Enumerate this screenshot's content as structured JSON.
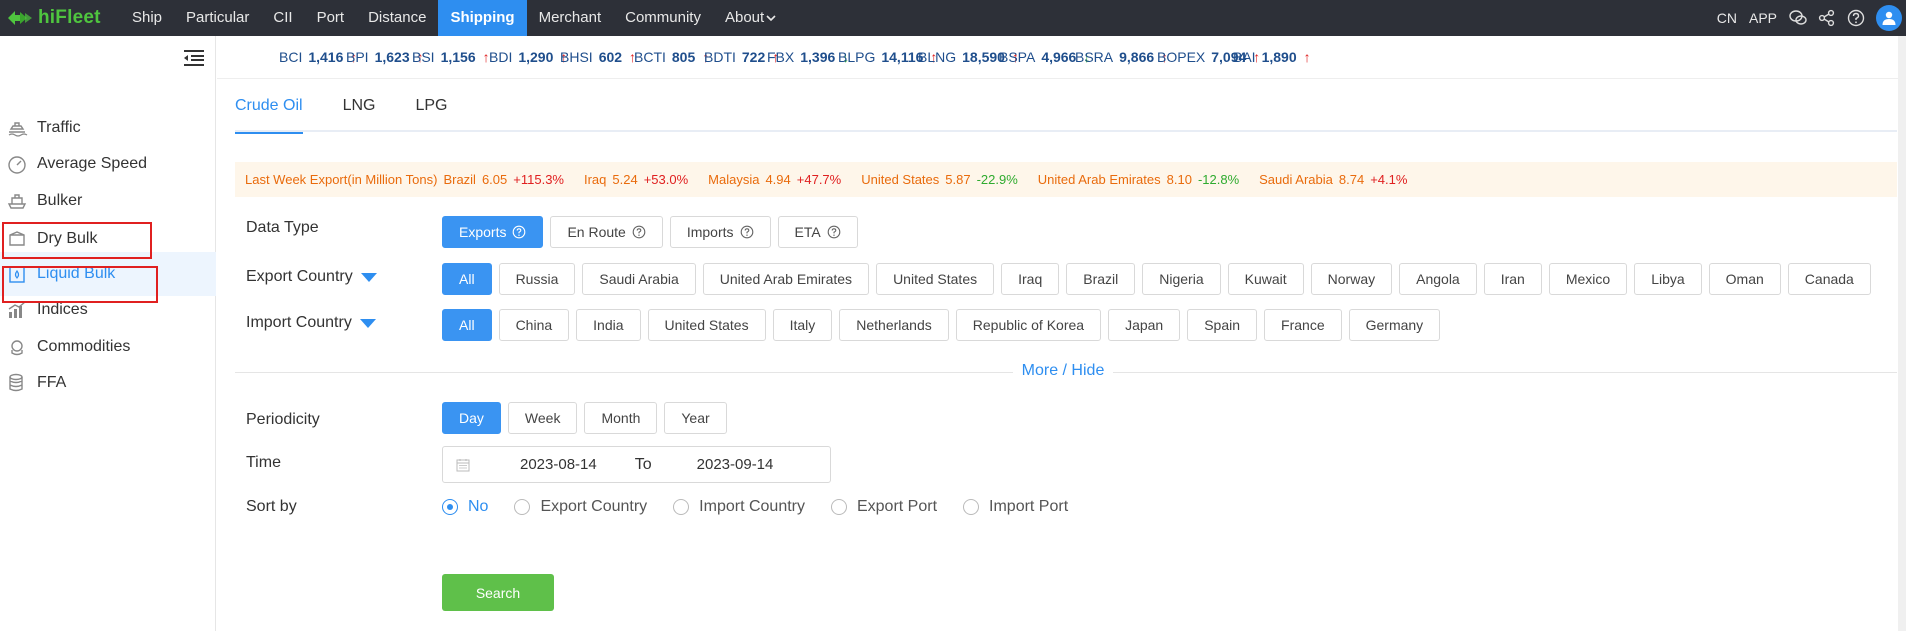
{
  "brand": {
    "name": "hiFleet",
    "color": "#4fc53f"
  },
  "nav": {
    "items": [
      "Ship",
      "Particular",
      "CII",
      "Port",
      "Distance",
      "Shipping",
      "Merchant",
      "Community",
      "About"
    ],
    "active": "Shipping",
    "right": {
      "lang": "CN",
      "app": "APP"
    },
    "icons": [
      "wechat-icon",
      "share-icon",
      "help-icon",
      "user-avatar-icon"
    ]
  },
  "sidebar": {
    "items": [
      {
        "label": "Traffic",
        "icon": "traffic-icon"
      },
      {
        "label": "Average Speed",
        "icon": "speedometer-icon"
      },
      {
        "label": "Bulker",
        "icon": "bulker-ship-icon"
      },
      {
        "label": "Dry Bulk",
        "icon": "dry-bulk-box-icon"
      },
      {
        "label": "Liquid Bulk",
        "icon": "liquid-bulk-icon"
      },
      {
        "label": "Indices",
        "icon": "bar-chart-icon"
      },
      {
        "label": "Commodities",
        "icon": "coins-icon"
      },
      {
        "label": "FFA",
        "icon": "database-icon"
      }
    ],
    "active": "Liquid Bulk"
  },
  "ticker": [
    {
      "name": "BCI",
      "value": "1,416",
      "dir": "up"
    },
    {
      "name": "BPI",
      "value": "1,623",
      "dir": "up"
    },
    {
      "name": "BSI",
      "value": "1,156",
      "dir": "up"
    },
    {
      "name": "BDI",
      "value": "1,290",
      "dir": "up"
    },
    {
      "name": "BHSI",
      "value": "602",
      "dir": "up"
    },
    {
      "name": "BCTI",
      "value": "805",
      "dir": "up"
    },
    {
      "name": "BDTI",
      "value": "722",
      "dir": "up"
    },
    {
      "name": "FBX",
      "value": "1,396",
      "dir": "down"
    },
    {
      "name": "BLPG",
      "value": "14,116",
      "dir": "up"
    },
    {
      "name": "BLNG",
      "value": "18,590",
      "dir": "up"
    },
    {
      "name": "BSPA",
      "value": "4,966",
      "dir": "down"
    },
    {
      "name": "BSRA",
      "value": "9,866",
      "dir": "up"
    },
    {
      "name": "BOPEX",
      "value": "7,094",
      "dir": "up"
    },
    {
      "name": "BAI",
      "value": "1,890",
      "dir": "up"
    }
  ],
  "tabs": [
    "Crude Oil",
    "LNG",
    "LPG"
  ],
  "active_tab": "Crude Oil",
  "alert": {
    "title": "Last Week Export(in Million Tons)",
    "entries": [
      {
        "country": "Brazil",
        "value": "6.05",
        "change": "+115.3%",
        "dir": "up"
      },
      {
        "country": "Iraq",
        "value": "5.24",
        "change": "+53.0%",
        "dir": "up"
      },
      {
        "country": "Malaysia",
        "value": "4.94",
        "change": "+47.7%",
        "dir": "up"
      },
      {
        "country": "United States",
        "value": "5.87",
        "change": "-22.9%",
        "dir": "down"
      },
      {
        "country": "United Arab Emirates",
        "value": "8.10",
        "change": "-12.8%",
        "dir": "down"
      },
      {
        "country": "Saudi Arabia",
        "value": "8.74",
        "change": "+4.1%",
        "dir": "up"
      }
    ]
  },
  "form": {
    "data_type": {
      "label": "Data Type",
      "options": [
        "Exports",
        "En Route",
        "Imports",
        "ETA"
      ],
      "selected": "Exports"
    },
    "export_country": {
      "label": "Export Country",
      "options": [
        "All",
        "Russia",
        "Saudi Arabia",
        "United Arab Emirates",
        "United States",
        "Iraq",
        "Brazil",
        "Nigeria",
        "Kuwait",
        "Norway",
        "Angola",
        "Iran",
        "Mexico",
        "Libya",
        "Oman",
        "Canada"
      ],
      "selected": "All"
    },
    "import_country": {
      "label": "Import Country",
      "options": [
        "All",
        "China",
        "India",
        "United States",
        "Italy",
        "Netherlands",
        "Republic of Korea",
        "Japan",
        "Spain",
        "France",
        "Germany"
      ],
      "selected": "All"
    },
    "more_hide": "More / Hide",
    "periodicity": {
      "label": "Periodicity",
      "options": [
        "Day",
        "Week",
        "Month",
        "Year"
      ],
      "selected": "Day"
    },
    "time": {
      "label": "Time",
      "from": "2023-08-14",
      "to_label": "To",
      "to": "2023-09-14"
    },
    "sort_by": {
      "label": "Sort by",
      "options": [
        "No",
        "Export Country",
        "Import Country",
        "Export Port",
        "Import Port"
      ],
      "selected": "No"
    },
    "search_label": "Search"
  },
  "colors": {
    "accent": "#2e8ef0",
    "up": "#e02020",
    "down": "#2fab2f",
    "warning": "#e96b0c",
    "search": "#5fc04a",
    "highlight_box": "#e02020"
  }
}
